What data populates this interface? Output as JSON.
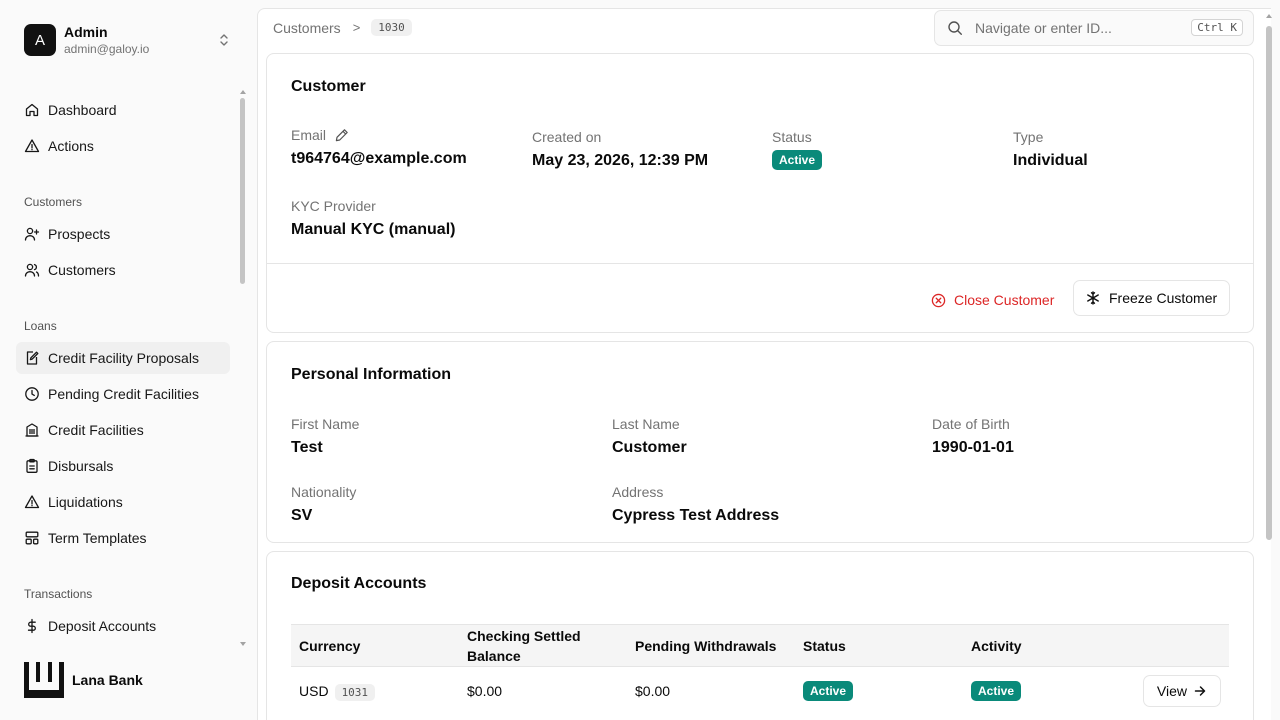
{
  "user": {
    "initial": "A",
    "name": "Admin",
    "email": "admin@galoy.io"
  },
  "nav": {
    "top": [
      {
        "label": "Dashboard",
        "icon": "home-icon"
      },
      {
        "label": "Actions",
        "icon": "alert-triangle-icon"
      }
    ],
    "customers_group": "Customers",
    "customers": [
      {
        "label": "Prospects",
        "icon": "user-plus-icon"
      },
      {
        "label": "Customers",
        "icon": "users-icon"
      }
    ],
    "loans_group": "Loans",
    "loans": [
      {
        "label": "Credit Facility Proposals",
        "icon": "file-edit-icon",
        "active": true
      },
      {
        "label": "Pending Credit Facilities",
        "icon": "clock-icon"
      },
      {
        "label": "Credit Facilities",
        "icon": "bank-icon"
      },
      {
        "label": "Disbursals",
        "icon": "clipboard-icon"
      },
      {
        "label": "Liquidations",
        "icon": "alert-triangle-icon"
      },
      {
        "label": "Term Templates",
        "icon": "layout-icon"
      }
    ],
    "transactions_group": "Transactions",
    "transactions": [
      {
        "label": "Deposit Accounts",
        "icon": "dollar-icon"
      }
    ]
  },
  "brand": {
    "name": "Lana Bank"
  },
  "breadcrumb": {
    "root": "Customers",
    "sep": ">",
    "id": "1030"
  },
  "search": {
    "placeholder": "Navigate or enter ID...",
    "shortcut": "Ctrl K"
  },
  "customer": {
    "title": "Customer",
    "email_label": "Email",
    "email": "t964764@example.com",
    "created_label": "Created on",
    "created": "May 23, 2026, 12:39 PM",
    "status_label": "Status",
    "status": "Active",
    "type_label": "Type",
    "type": "Individual",
    "kyc_label": "KYC Provider",
    "kyc": "Manual KYC (manual)",
    "close_label": "Close Customer",
    "freeze_label": "Freeze Customer"
  },
  "personal": {
    "title": "Personal Information",
    "first_name_label": "First Name",
    "first_name": "Test",
    "last_name_label": "Last Name",
    "last_name": "Customer",
    "dob_label": "Date of Birth",
    "dob": "1990-01-01",
    "nationality_label": "Nationality",
    "nationality": "SV",
    "address_label": "Address",
    "address": "Cypress Test Address"
  },
  "deposits": {
    "title": "Deposit Accounts",
    "headers": [
      "Currency",
      "Checking Settled Balance",
      "Pending Withdrawals",
      "Status",
      "Activity",
      ""
    ],
    "rows": [
      {
        "currency": "USD",
        "id": "1031",
        "settled": "$0.00",
        "pending": "$0.00",
        "status": "Active",
        "activity": "Active",
        "action": "View"
      }
    ]
  },
  "colors": {
    "accent_active": "#0a8a7a",
    "danger": "#dc2626"
  }
}
